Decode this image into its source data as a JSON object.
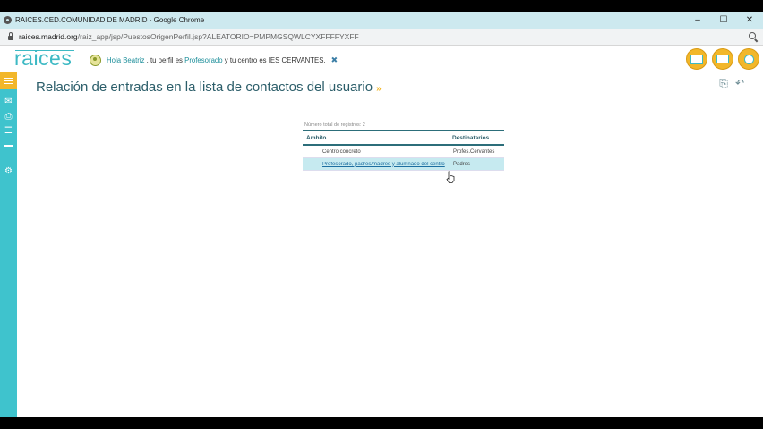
{
  "browser": {
    "title": "RAICES.CED.COMUNIDAD DE MADRID - Google Chrome",
    "url_host": "raices.madrid.org",
    "url_path": "/raiz_app/jsp/PuestosOrigenPerfil.jsp?ALEATORIO=PMPMGSQWLCYXFFFFYXFF",
    "controls": {
      "minimize": "–",
      "maximize": "☐",
      "close": "✕"
    }
  },
  "header": {
    "logo": "raices",
    "greeting": "Hola Beatriz",
    "profile_text": ", tu perfil es",
    "profile": "Profesorado",
    "center_text": "y tu centro es IES",
    "center": "CERVANTES.",
    "close_glyph": "✖"
  },
  "icons": {
    "mail": "mail-icon",
    "print": "print-icon",
    "settings": "gear-icon"
  },
  "sidebar": {
    "items": [
      "menu-icon",
      "mail-icon",
      "printer-icon",
      "list-icon",
      "bed-icon",
      "gear-icon"
    ]
  },
  "main": {
    "title": "Relación de entradas en la lista de contactos del usuario",
    "title_arrow": "»",
    "total_records": "Número total de registros: 2",
    "columns": [
      "Ámbito",
      "Destinatarios"
    ],
    "rows": [
      {
        "ambito": "Centro concreto",
        "destinatarios": "Profes.Cervantes"
      },
      {
        "ambito": "Profesorado, padres/madres y alumnado del centro",
        "destinatarios": "Padres"
      }
    ]
  },
  "colors": {
    "accent": "#3fc3cd",
    "highlight": "#f2b72a",
    "selected_row": "#c6eaf0"
  }
}
